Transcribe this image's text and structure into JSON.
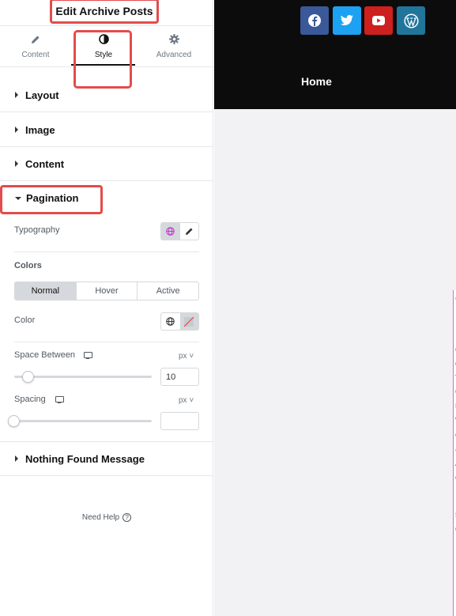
{
  "panel": {
    "title": "Edit Archive Posts",
    "tabs": [
      {
        "label": "Content",
        "icon": "pencil-icon"
      },
      {
        "label": "Style",
        "icon": "half-circle-icon"
      },
      {
        "label": "Advanced",
        "icon": "gear-icon"
      }
    ],
    "sections": {
      "layout": "Layout",
      "image": "Image",
      "content": "Content",
      "pagination": "Pagination",
      "nothing_found": "Nothing Found Message"
    },
    "pagination": {
      "typography_label": "Typography",
      "colors_heading": "Colors",
      "state_tabs": [
        "Normal",
        "Hover",
        "Active"
      ],
      "color_label": "Color",
      "space_between_label": "Space Between",
      "space_between_unit": "px",
      "space_between_value": "10",
      "space_between_level": 0.1,
      "spacing_label": "Spacing",
      "spacing_unit": "px",
      "spacing_value": "",
      "spacing_level": 0
    },
    "need_help": "Need Help",
    "help_icon_char": "?"
  },
  "preview": {
    "nav_home": "Home",
    "social_icons": [
      {
        "name": "facebook-icon",
        "color": "#3b5998"
      },
      {
        "name": "twitter-icon",
        "color": "#1da1f2"
      },
      {
        "name": "youtube-icon",
        "color": "#cd201f"
      },
      {
        "name": "wordpress-icon",
        "color": "#21759b"
      }
    ],
    "edge_letters": [
      "C",
      "I",
      "c",
      "e",
      "f",
      "c",
      "r",
      "v",
      "c",
      "a",
      "A",
      "c",
      "s",
      "c"
    ]
  },
  "colors": {
    "highlight": "#e34c4c",
    "accent_pink": "#c36ed0"
  }
}
